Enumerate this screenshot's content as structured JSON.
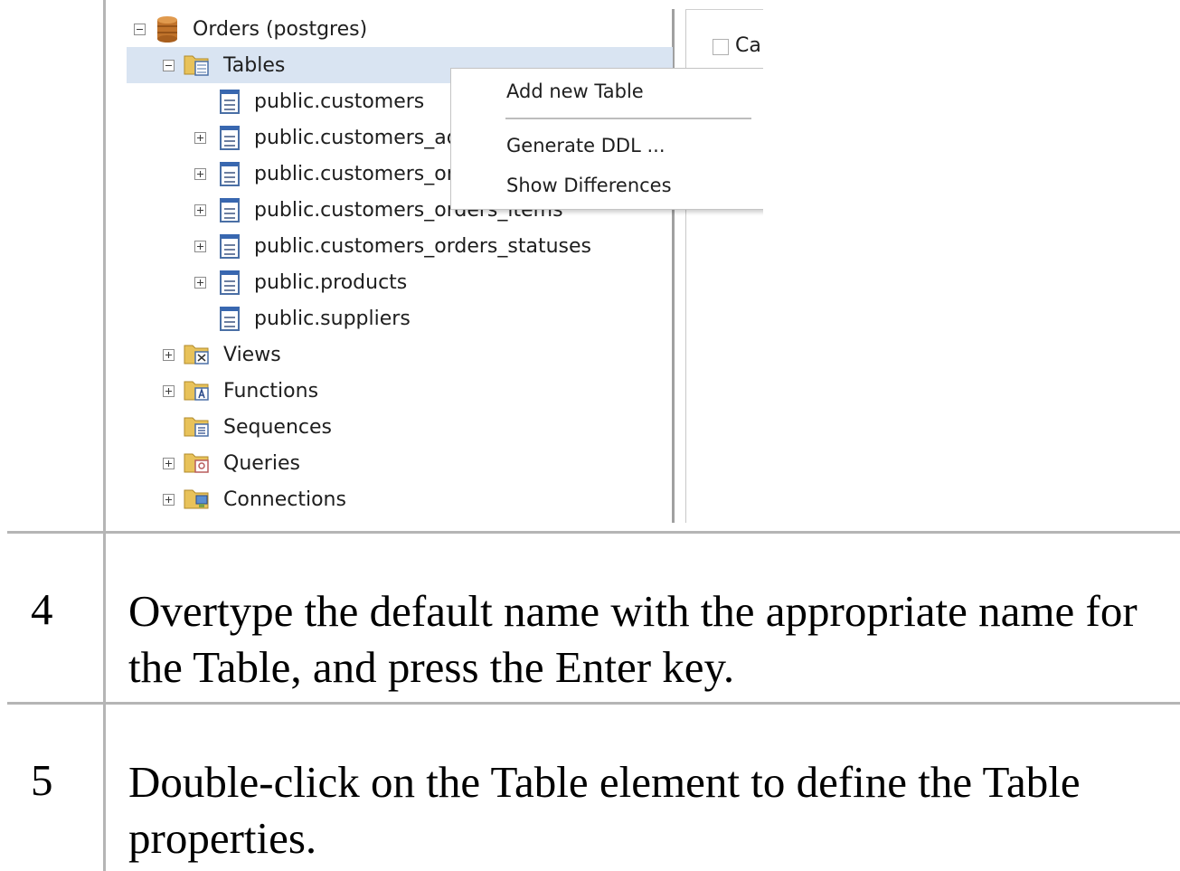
{
  "tree": {
    "root_label": "Orders (postgres)",
    "tables_label": "Tables",
    "tables": [
      {
        "label": "public.customers",
        "expandable": false
      },
      {
        "label": "public.customers_addresses",
        "expandable": true
      },
      {
        "label": "public.customers_orders",
        "expandable": true
      },
      {
        "label": "public.customers_orders_items",
        "expandable": true
      },
      {
        "label": "public.customers_orders_statuses",
        "expandable": true
      },
      {
        "label": "public.products",
        "expandable": true
      },
      {
        "label": "public.suppliers",
        "expandable": false
      }
    ],
    "folders": [
      {
        "label": "Views",
        "expandable": true,
        "icon": "views-folder-icon"
      },
      {
        "label": "Functions",
        "expandable": true,
        "icon": "functions-folder-icon"
      },
      {
        "label": "Sequences",
        "expandable": false,
        "icon": "sequences-folder-icon"
      },
      {
        "label": "Queries",
        "expandable": true,
        "icon": "queries-folder-icon"
      },
      {
        "label": "Connections",
        "expandable": true,
        "icon": "connections-folder-icon"
      }
    ]
  },
  "right_pane": {
    "checkbox_label": "Ca"
  },
  "context_menu": {
    "items": [
      "Add new Table",
      "Generate DDL ...",
      "Show Differences"
    ]
  },
  "steps": [
    {
      "number": "4",
      "text": "Overtype the default name with the appropriate name for the Table, and press the Enter key."
    },
    {
      "number": "5",
      "text": "Double-click on the Table element to define the Table properties."
    }
  ],
  "colors": {
    "selection": "#d9e4f2",
    "border": "#b5b5b5"
  }
}
